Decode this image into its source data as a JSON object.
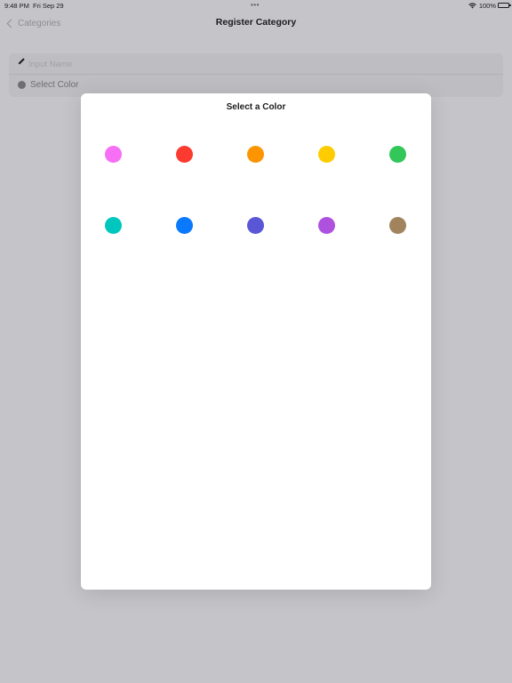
{
  "status_bar": {
    "time": "9:48 PM",
    "date": "Fri Sep 29",
    "multitask_indicator": "•••",
    "battery": "100%"
  },
  "nav": {
    "back_label": "Categories",
    "title": "Register Category"
  },
  "form": {
    "name_placeholder": "Input Name",
    "name_value": "",
    "select_color_label": "Select Color"
  },
  "modal": {
    "title": "Select a Color",
    "colors": [
      {
        "name": "pink",
        "hex": "#f76ff5"
      },
      {
        "name": "red",
        "hex": "#fb3b30"
      },
      {
        "name": "orange",
        "hex": "#fd9502"
      },
      {
        "name": "yellow",
        "hex": "#fecc00"
      },
      {
        "name": "green",
        "hex": "#33c759"
      },
      {
        "name": "teal",
        "hex": "#00c7be"
      },
      {
        "name": "blue",
        "hex": "#0a79fd"
      },
      {
        "name": "indigo",
        "hex": "#5957d6"
      },
      {
        "name": "purple",
        "hex": "#ae51df"
      },
      {
        "name": "brown",
        "hex": "#a1845e"
      }
    ]
  }
}
